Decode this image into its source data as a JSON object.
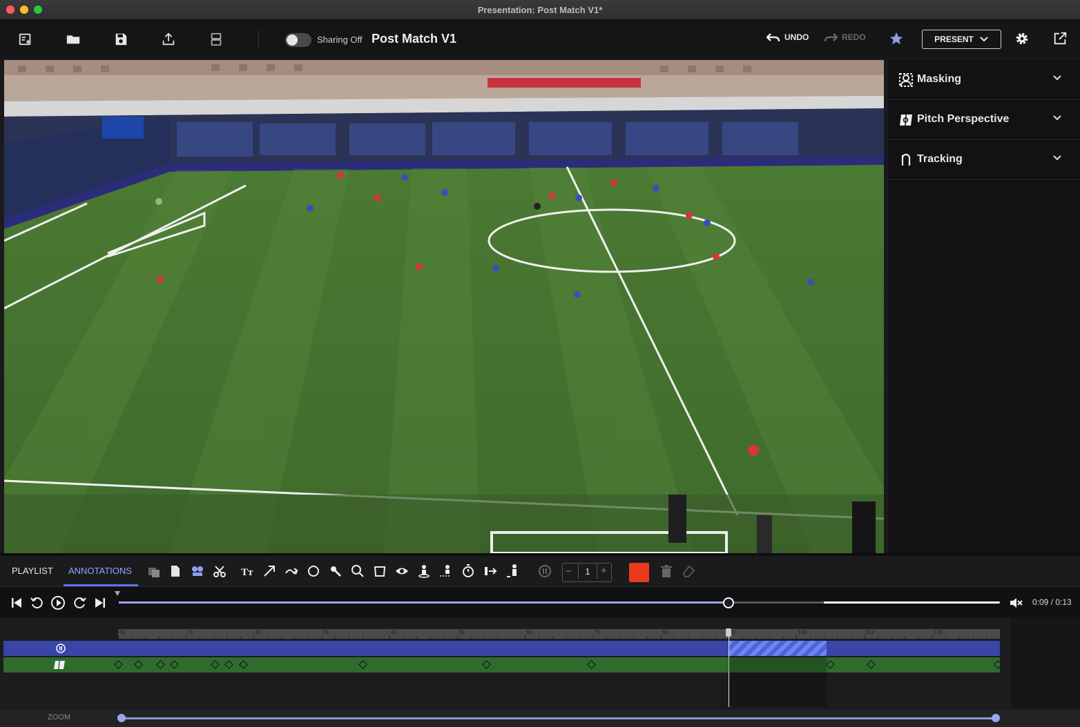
{
  "window": {
    "title": "Presentation: Post Match V1*"
  },
  "toolbar": {
    "sharing_label": "Sharing Off",
    "sharing_on": false,
    "presentation_title": "Post Match V1",
    "undo_label": "UNDO",
    "redo_label": "REDO",
    "present_label": "PRESENT",
    "icons": [
      "new-presentation-icon",
      "open-folder-icon",
      "save-icon",
      "export-icon",
      "layout-icon"
    ]
  },
  "right_panel": {
    "items": [
      {
        "label": "Masking",
        "icon": "masking-icon"
      },
      {
        "label": "Pitch Perspective",
        "icon": "pitch-perspective-icon"
      },
      {
        "label": "Tracking",
        "icon": "tracking-icon"
      }
    ]
  },
  "annotation_bar": {
    "tabs": [
      {
        "label": "PLAYLIST",
        "active": false
      },
      {
        "label": "ANNOTATIONS",
        "active": true
      }
    ],
    "stepper_value": "1",
    "stepper_minus": "−",
    "stepper_plus": "+",
    "color": "#ea3a1c"
  },
  "transport": {
    "time": "0:09 / 0:13",
    "current_seconds": 9,
    "duration_seconds": 13,
    "buffered_fraction": 0.8
  },
  "timeline": {
    "ruler_labels": [
      "0s",
      "1s",
      "2s",
      "3s",
      "4s",
      "5s",
      "6s",
      "7s",
      "8s",
      "9s",
      "10s",
      "11s",
      "12s",
      "13"
    ],
    "mask_clip": {
      "start": 9.0,
      "end": 10.45
    },
    "keyframes": [
      0.0,
      0.3,
      0.62,
      0.82,
      1.43,
      1.63,
      1.84,
      3.6,
      5.43,
      6.97,
      10.5,
      11.1,
      13.0
    ]
  },
  "zoom": {
    "label": "ZOOM",
    "start": 0.0,
    "end": 1.0
  },
  "colors": {
    "accent": "#5c74e6",
    "mask_lane": "#3a45a8",
    "pitch_lane": "#2f6b2d"
  }
}
